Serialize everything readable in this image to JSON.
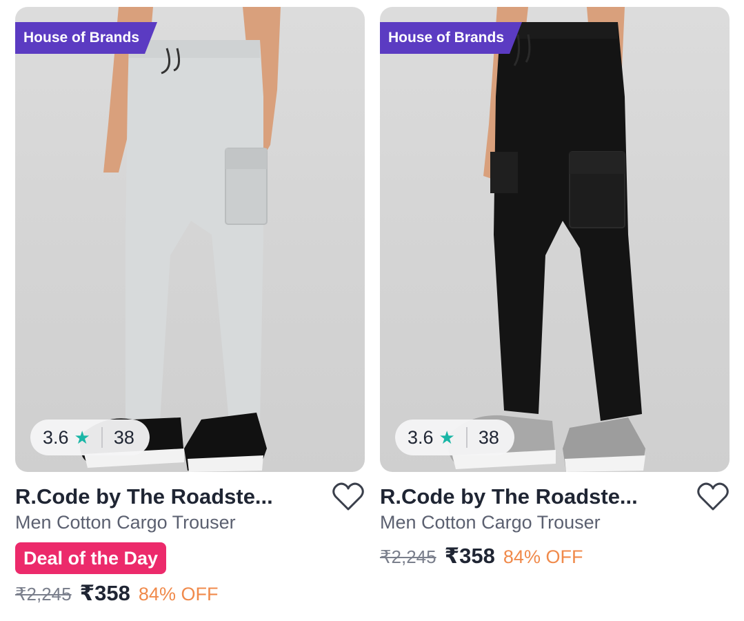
{
  "products": [
    {
      "brand_tag": "House of Brands",
      "rating": "3.6",
      "rating_count": "38",
      "brand_name": "R.Code by The Roadste...",
      "subtitle": "Men Cotton Cargo Trouser",
      "deal_label": "Deal of the Day",
      "mrp": "₹2,245",
      "price": "₹358",
      "discount": "84% OFF",
      "pant_color": "#d7dadb",
      "wishlist_icon": "heart-outline-icon"
    },
    {
      "brand_tag": "House of Brands",
      "rating": "3.6",
      "rating_count": "38",
      "brand_name": "R.Code by The Roadste...",
      "subtitle": "Men Cotton Cargo Trouser",
      "mrp": "₹2,245",
      "price": "₹358",
      "discount": "84% OFF",
      "pant_color": "#141414",
      "wishlist_icon": "heart-outline-icon"
    }
  ],
  "colors": {
    "brand_tag_bg": "#5b3bc2",
    "deal_bg": "#ec2a6b",
    "star": "#19b6a6",
    "discount": "#f08a4b"
  }
}
